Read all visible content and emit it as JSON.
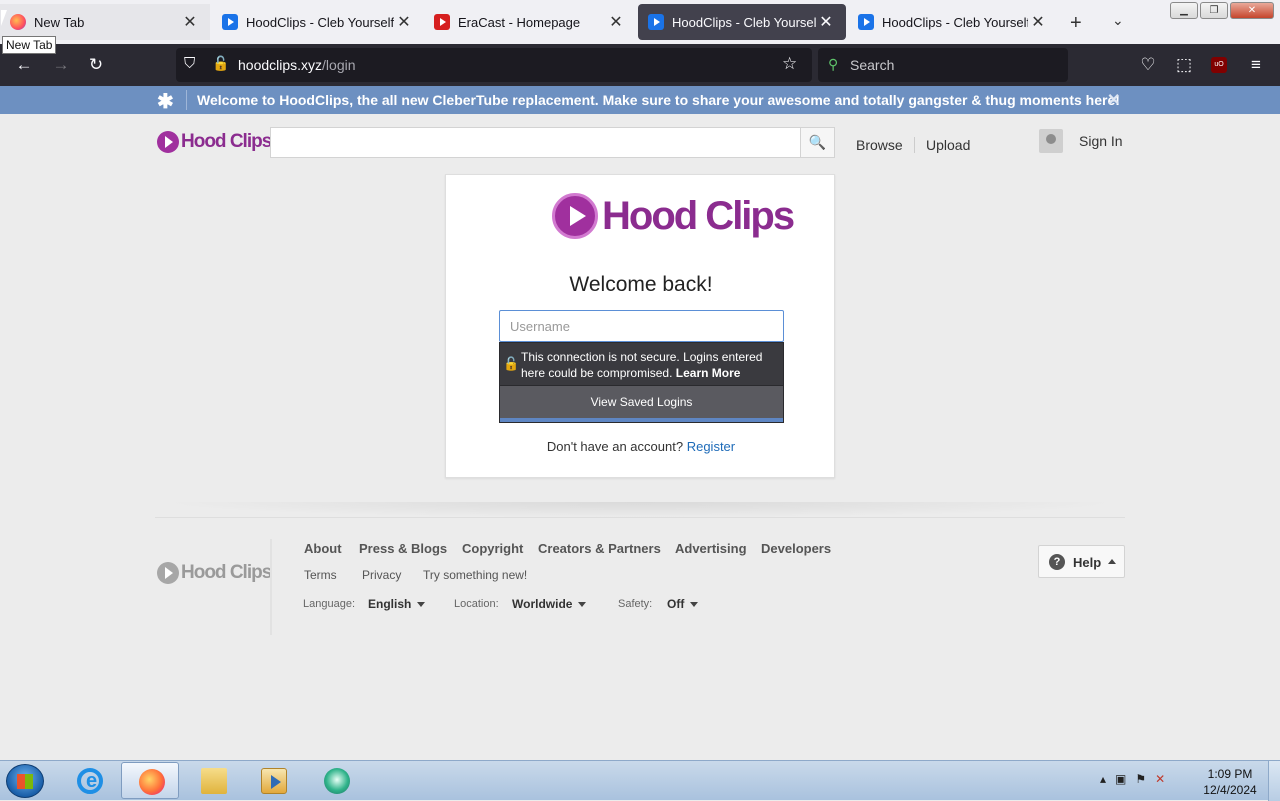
{
  "browser": {
    "tabs": [
      {
        "title": "New Tab",
        "icon": "firefox-icon",
        "active": false
      },
      {
        "title": "HoodClips - Cleb Yourself",
        "icon": "hoodclips-favicon",
        "active": false
      },
      {
        "title": "EraCast - Homepage",
        "icon": "eracast-favicon",
        "active": false
      },
      {
        "title": "HoodClips - Cleb Yourself",
        "icon": "hoodclips-favicon",
        "active": true
      },
      {
        "title": "HoodClips - Cleb Yourself",
        "icon": "hoodclips-favicon",
        "active": false
      }
    ],
    "tooltip": "New Tab",
    "url_host": "hoodclips.xyz",
    "url_path": "/login",
    "search_placeholder": "Search"
  },
  "notice": {
    "message": "Welcome to HoodClips, the all new CleberTube replacement. Make sure to share your awesome and totally gangster & thug moments here!"
  },
  "header": {
    "logo_text": "Hood Clips",
    "browse": "Browse",
    "upload": "Upload",
    "sign_in": "Sign In"
  },
  "login": {
    "logo_text": "Hood Clips",
    "heading": "Welcome back!",
    "username_placeholder": "Username",
    "insecure_warning": "This connection is not secure. Logins entered here could be compromised.",
    "learn_more": "Learn More",
    "view_saved": "View Saved Logins",
    "no_account": "Don't have an account?",
    "register": "Register"
  },
  "footer": {
    "logo_text": "Hood Clips",
    "links_row1": [
      "About",
      "Press & Blogs",
      "Copyright",
      "Creators & Partners",
      "Advertising",
      "Developers"
    ],
    "links_row2": [
      "Terms",
      "Privacy",
      "Try something new!"
    ],
    "language_label": "Language:",
    "language_value": "English",
    "location_label": "Location:",
    "location_value": "Worldwide",
    "safety_label": "Safety:",
    "safety_value": "Off",
    "help": "Help"
  },
  "taskbar": {
    "time": "1:09 PM",
    "date": "12/4/2024"
  },
  "colors": {
    "brand_purple": "#a0309e",
    "notice_bar": "#6d90c1",
    "link_blue": "#1e6bb8"
  }
}
